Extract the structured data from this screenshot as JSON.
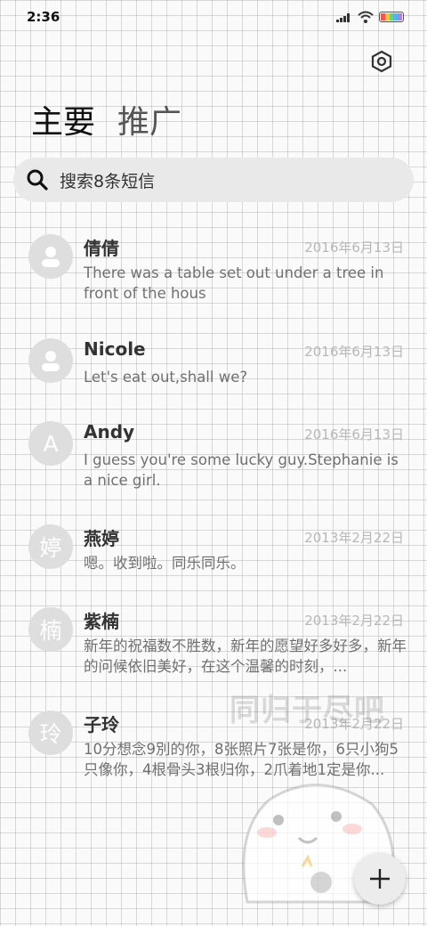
{
  "status": {
    "time": "2:36"
  },
  "header": {
    "tab_main": "主要",
    "tab_promo": "推广"
  },
  "search": {
    "label": "搜索8条短信"
  },
  "conversations": [
    {
      "name": "倩倩",
      "date": "2016年6月13日",
      "preview": "There was a table set out under a tree in front of the hous",
      "avatar": "person"
    },
    {
      "name": "Nicole",
      "date": "2016年6月13日",
      "preview": "Let's eat out,shall we?",
      "avatar": "person"
    },
    {
      "name": "Andy",
      "date": "2016年6月13日",
      "preview": "I guess you're some lucky guy.Stephanie is a nice girl.",
      "avatar": "A"
    },
    {
      "name": "燕婷",
      "date": "2013年2月22日",
      "preview": "嗯。收到啦。同乐同乐。",
      "avatar": "婷"
    },
    {
      "name": "紫楠",
      "date": "2013年2月22日",
      "preview": "新年的祝福数不胜数，新年的愿望好多好多，新年的问候依旧美好，在这个温馨的时刻，...",
      "avatar": "楠"
    },
    {
      "name": "子玲",
      "date": "2013年2月22日",
      "preview": "10分想念9別的你，8张照片7张是你，6只小狗5只像你，4根骨头3根归你，2爪着地1定是你...",
      "avatar": "玲"
    }
  ],
  "watermark": {
    "text": "同归于尽吧"
  },
  "colors": {
    "avatar_bg": "#dedede",
    "search_bg": "#e9e9e9",
    "date": "#b8b8b8"
  }
}
